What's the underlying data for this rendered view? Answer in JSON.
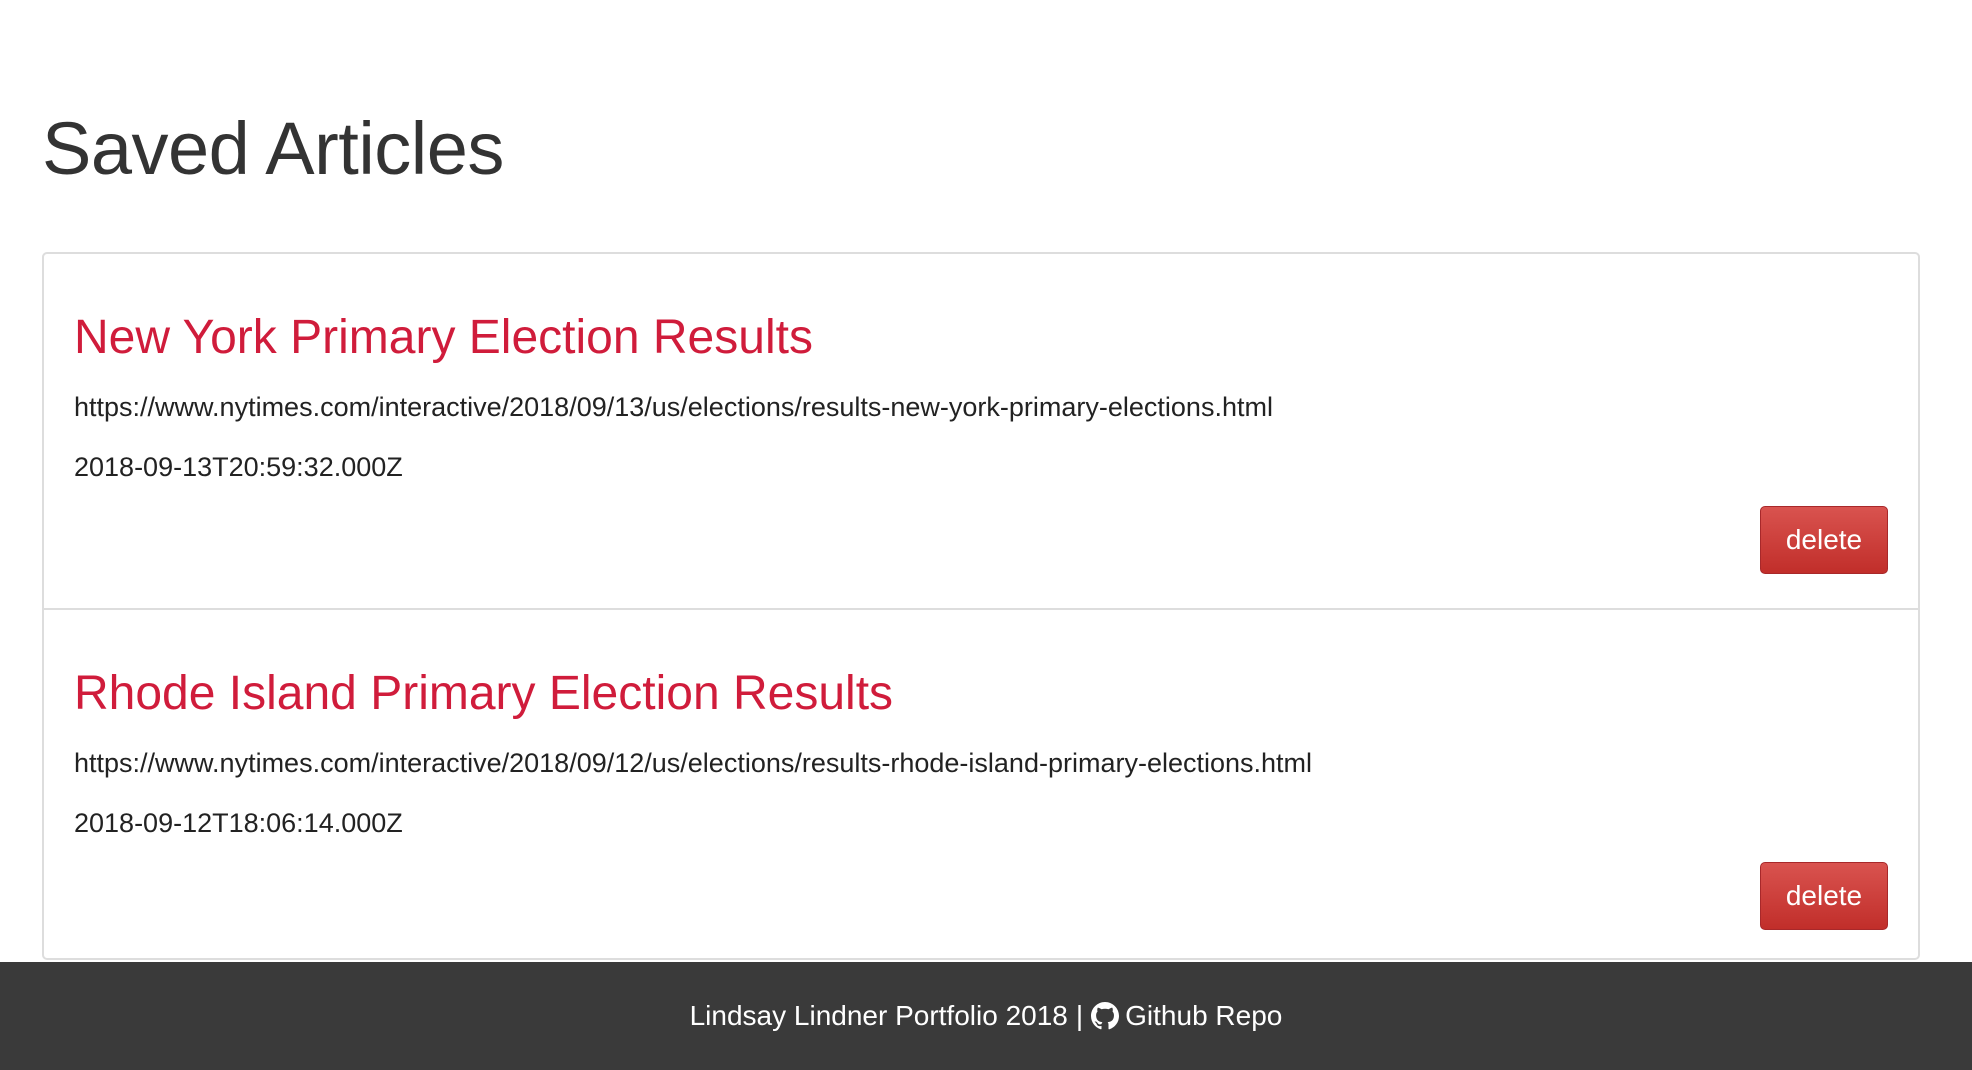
{
  "page": {
    "title": "Saved Articles"
  },
  "articles": [
    {
      "title": "New York Primary Election Results",
      "url": "https://www.nytimes.com/interactive/2018/09/13/us/elections/results-new-york-primary-elections.html",
      "date": "2018-09-13T20:59:32.000Z",
      "delete_label": "delete"
    },
    {
      "title": "Rhode Island Primary Election Results",
      "url": "https://www.nytimes.com/interactive/2018/09/12/us/elections/results-rhode-island-primary-elections.html",
      "date": "2018-09-12T18:06:14.000Z",
      "delete_label": "delete"
    }
  ],
  "footer": {
    "credit": "Lindsay Lindner Portfolio 2018",
    "separator": "|",
    "repo_link_label": "Github Repo",
    "repo_icon": "github-icon"
  },
  "colors": {
    "article_title": "#d01c3b",
    "delete_button": "#d9534f",
    "footer_background": "#3a3a3a"
  }
}
